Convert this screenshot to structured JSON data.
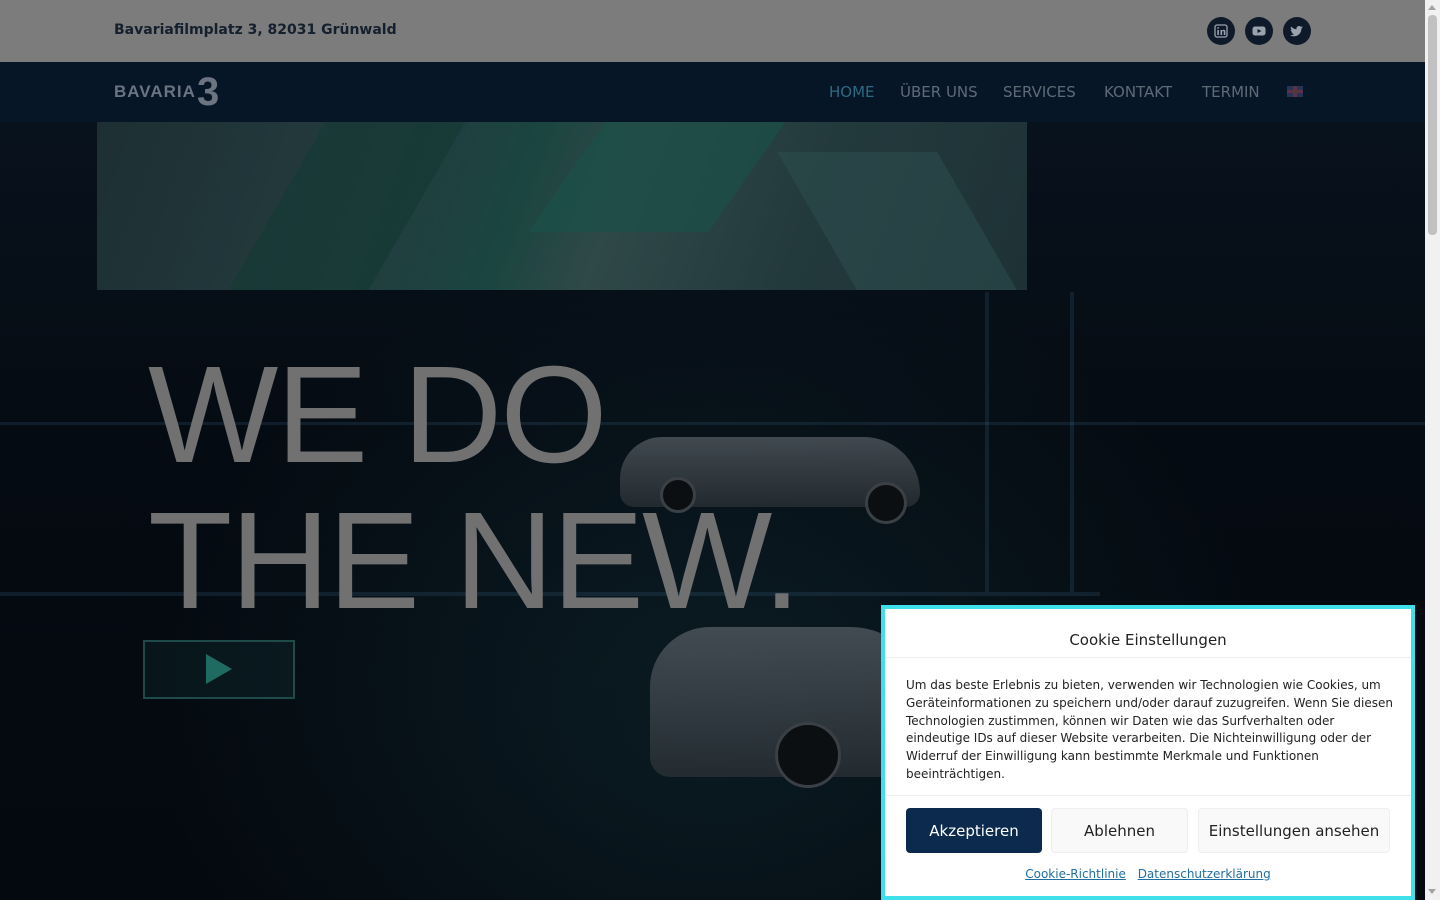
{
  "topbar": {
    "address": "Bavariafilmplatz 3, 82031 Grünwald",
    "social": [
      "linkedin-icon",
      "youtube-icon",
      "twitter-icon"
    ]
  },
  "nav": {
    "logo_word": "BAVARIA",
    "logo_number": "3",
    "items": [
      {
        "label": "HOME",
        "active": true
      },
      {
        "label": "ÜBER UNS"
      },
      {
        "label": "SERVICES"
      },
      {
        "label": "KONTAKT"
      },
      {
        "label": "TERMIN"
      }
    ],
    "language_flag": "uk-flag-icon"
  },
  "hero": {
    "line1": "WE DO",
    "line2": "THE NEW.",
    "play_icon": "play-icon"
  },
  "cookie": {
    "title": "Cookie Einstellungen",
    "text": "Um das beste Erlebnis zu bieten, verwenden wir Technologien wie Cookies, um Geräteinformationen zu speichern und/oder darauf zuzugreifen. Wenn Sie diesen Technologien zustimmen, können wir Daten wie das Surfverhalten oder eindeutige IDs auf dieser Website verarbeiten. Die Nichteinwilligung oder der Widerruf der Einwilligung kann bestimmte Merkmale und Funktionen beeinträchtigen.",
    "accept": "Akzeptieren",
    "deny": "Ablehnen",
    "settings": "Einstellungen ansehen",
    "link_policy": "Cookie-Richtlinie",
    "link_privacy": "Datenschutzerklärung"
  },
  "colors": {
    "accent": "#3fe0ea",
    "primary_button": "#0b2a4e",
    "nav_bg": "#061627"
  }
}
